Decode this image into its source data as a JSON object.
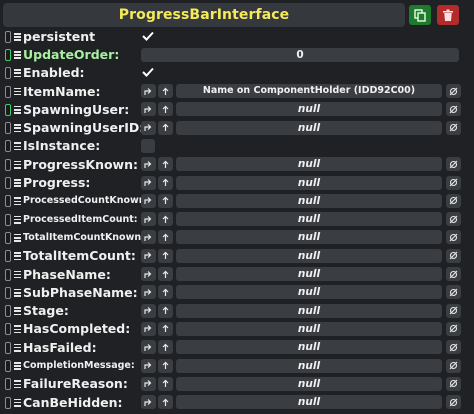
{
  "header": {
    "title": "ProgressBarInterface"
  },
  "fields": {
    "persistent": {
      "label": "persistent",
      "checked": true
    },
    "update_order": {
      "label": "UpdateOrder:",
      "value": "0"
    },
    "enabled": {
      "label": "Enabled:",
      "checked": true
    },
    "item_name": {
      "label": "ItemName:",
      "value": "Name on ComponentHolder (IDD92C00)"
    },
    "spawning_user": {
      "label": "SpawningUser:",
      "value": "null"
    },
    "spawning_user_id": {
      "label": "SpawningUserID:",
      "value": "null"
    },
    "is_instance": {
      "label": "IsInstance:",
      "checked": false
    },
    "progress_known": {
      "label": "ProgressKnown:",
      "value": "null"
    },
    "progress": {
      "label": "Progress:",
      "value": "null"
    },
    "processed_count_known": {
      "label": "ProcessedCountKnown:",
      "value": "null"
    },
    "processed_item_count": {
      "label": "ProcessedItemCount:",
      "value": "null"
    },
    "total_item_count_known": {
      "label": "TotalItemCountKnown:",
      "value": "null"
    },
    "total_item_count": {
      "label": "TotalItemCount:",
      "value": "null"
    },
    "phase_name": {
      "label": "PhaseName:",
      "value": "null"
    },
    "sub_phase_name": {
      "label": "SubPhaseName:",
      "value": "null"
    },
    "stage": {
      "label": "Stage:",
      "value": "null"
    },
    "has_completed": {
      "label": "HasCompleted:",
      "value": "null"
    },
    "has_failed": {
      "label": "HasFailed:",
      "value": "null"
    },
    "completion_message": {
      "label": "CompletionMessage:",
      "value": "null"
    },
    "failure_reason": {
      "label": "FailureReason:",
      "value": "null"
    },
    "can_be_hidden": {
      "label": "CanBeHidden:",
      "value": "null"
    }
  },
  "icons": {
    "copy": "duplicate-icon",
    "delete": "trash-icon",
    "check": "checkmark-icon",
    "null": "null-set-icon"
  },
  "colors": {
    "title": "#f4ea5a",
    "accent_green": "#3dcf6a",
    "delete_red": "#b32b2b",
    "copy_green": "#1e7a2c"
  }
}
